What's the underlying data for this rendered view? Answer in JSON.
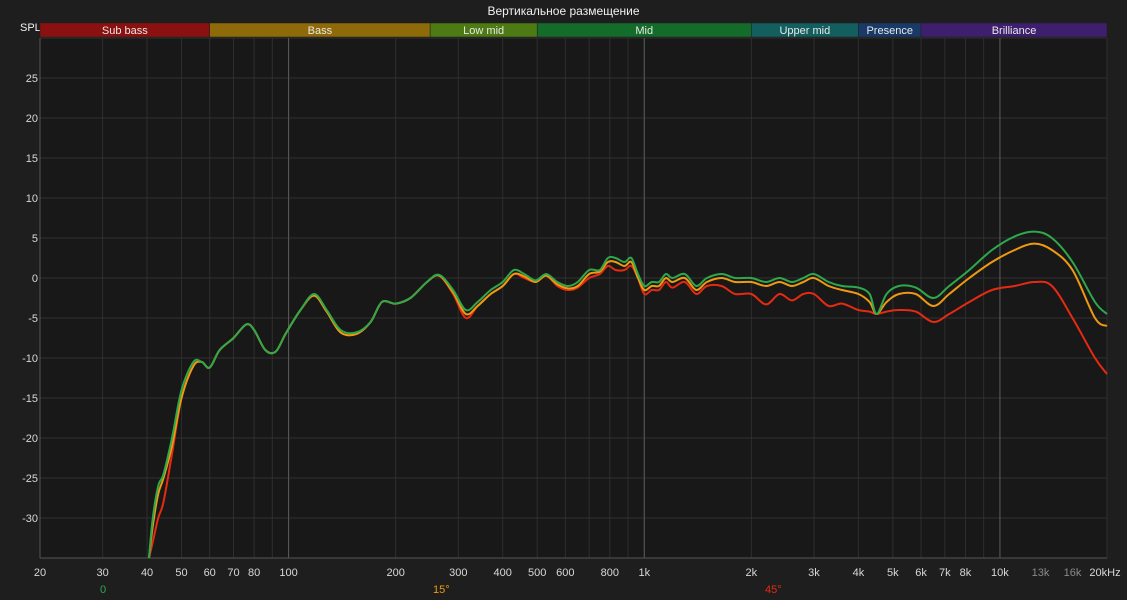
{
  "chart_data": {
    "type": "line",
    "title": "Вертикальное размещение",
    "ylabel": "SPL",
    "xscale": "log",
    "xlim": [
      20,
      20000
    ],
    "ylim": [
      -35,
      30
    ],
    "grid": true,
    "yticks": [
      25,
      20,
      15,
      10,
      5,
      0,
      -5,
      -10,
      -15,
      -20,
      -25,
      -30
    ],
    "xticks": [
      {
        "v": 20,
        "label": "20",
        "major": false
      },
      {
        "v": 30,
        "label": "30",
        "major": false
      },
      {
        "v": 40,
        "label": "40",
        "major": false
      },
      {
        "v": 50,
        "label": "50",
        "major": false
      },
      {
        "v": 60,
        "label": "60",
        "major": false
      },
      {
        "v": 70,
        "label": "70",
        "major": false
      },
      {
        "v": 80,
        "label": "80",
        "major": false
      },
      {
        "v": 100,
        "label": "100",
        "major": true
      },
      {
        "v": 200,
        "label": "200",
        "major": false
      },
      {
        "v": 300,
        "label": "300",
        "major": false
      },
      {
        "v": 400,
        "label": "400",
        "major": false
      },
      {
        "v": 500,
        "label": "500",
        "major": false
      },
      {
        "v": 600,
        "label": "600",
        "major": false
      },
      {
        "v": 800,
        "label": "800",
        "major": false
      },
      {
        "v": 1000,
        "label": "1k",
        "major": true
      },
      {
        "v": 2000,
        "label": "2k",
        "major": false
      },
      {
        "v": 3000,
        "label": "3k",
        "major": false
      },
      {
        "v": 4000,
        "label": "4k",
        "major": false
      },
      {
        "v": 5000,
        "label": "5k",
        "major": false
      },
      {
        "v": 6000,
        "label": "6k",
        "major": false
      },
      {
        "v": 7000,
        "label": "7k",
        "major": false
      },
      {
        "v": 8000,
        "label": "8k",
        "major": false
      },
      {
        "v": 10000,
        "label": "10k",
        "major": true
      },
      {
        "v": 13000,
        "label": "13k",
        "major": false,
        "dim": true
      },
      {
        "v": 16000,
        "label": "16k",
        "major": false,
        "dim": true
      },
      {
        "v": 20000,
        "label": "20kHz",
        "major": false
      }
    ],
    "bands": [
      {
        "label": "Sub bass",
        "from": 20,
        "to": 60,
        "color": "#8b1010"
      },
      {
        "label": "Bass",
        "from": 60,
        "to": 250,
        "color": "#8f6a08"
      },
      {
        "label": "Low mid",
        "from": 250,
        "to": 500,
        "color": "#4d7a12"
      },
      {
        "label": "Mid",
        "from": 500,
        "to": 2000,
        "color": "#136c2a"
      },
      {
        "label": "Upper mid",
        "from": 2000,
        "to": 4000,
        "color": "#135e5e"
      },
      {
        "label": "Presence",
        "from": 4000,
        "to": 6000,
        "color": "#193a66"
      },
      {
        "label": "Brilliance",
        "from": 6000,
        "to": 20000,
        "color": "#3e1f6e"
      }
    ],
    "series": [
      {
        "name": "0",
        "color": "#2ea84a",
        "points": [
          [
            40.5,
            -35
          ],
          [
            41.5,
            -30
          ],
          [
            43,
            -26
          ],
          [
            44.5,
            -24.5
          ],
          [
            47,
            -20
          ],
          [
            50,
            -14
          ],
          [
            54,
            -10.5
          ],
          [
            57,
            -10.5
          ],
          [
            60,
            -11.2
          ],
          [
            64,
            -9
          ],
          [
            70,
            -7.5
          ],
          [
            76,
            -5.8
          ],
          [
            80,
            -6.5
          ],
          [
            86,
            -9
          ],
          [
            92,
            -9.2
          ],
          [
            98,
            -7
          ],
          [
            108,
            -4
          ],
          [
            118,
            -2
          ],
          [
            128,
            -4
          ],
          [
            140,
            -6.5
          ],
          [
            155,
            -6.8
          ],
          [
            170,
            -5.5
          ],
          [
            183,
            -3
          ],
          [
            200,
            -3.2
          ],
          [
            220,
            -2.5
          ],
          [
            245,
            -0.5
          ],
          [
            265,
            0.4
          ],
          [
            290,
            -1.5
          ],
          [
            315,
            -4
          ],
          [
            340,
            -3
          ],
          [
            370,
            -1.5
          ],
          [
            400,
            -0.5
          ],
          [
            430,
            1
          ],
          [
            460,
            0.5
          ],
          [
            495,
            -0.3
          ],
          [
            530,
            0.5
          ],
          [
            570,
            -0.5
          ],
          [
            610,
            -1
          ],
          [
            650,
            -0.5
          ],
          [
            700,
            1
          ],
          [
            750,
            1
          ],
          [
            790,
            2.5
          ],
          [
            830,
            2.5
          ],
          [
            880,
            2
          ],
          [
            920,
            2.5
          ],
          [
            960,
            0.5
          ],
          [
            1000,
            -1
          ],
          [
            1050,
            -0.5
          ],
          [
            1100,
            -0.5
          ],
          [
            1150,
            0.5
          ],
          [
            1200,
            0
          ],
          [
            1300,
            0.5
          ],
          [
            1400,
            -1
          ],
          [
            1500,
            0
          ],
          [
            1650,
            0.5
          ],
          [
            1800,
            0
          ],
          [
            2000,
            0
          ],
          [
            2200,
            -0.5
          ],
          [
            2400,
            0
          ],
          [
            2600,
            -0.5
          ],
          [
            2800,
            0
          ],
          [
            3000,
            0.5
          ],
          [
            3300,
            -0.5
          ],
          [
            3600,
            -1
          ],
          [
            4000,
            -1.2
          ],
          [
            4300,
            -2
          ],
          [
            4500,
            -4.5
          ],
          [
            4800,
            -2
          ],
          [
            5200,
            -1
          ],
          [
            5800,
            -1.2
          ],
          [
            6500,
            -2.5
          ],
          [
            7200,
            -1
          ],
          [
            8200,
            1
          ],
          [
            9500,
            3.5
          ],
          [
            11000,
            5.2
          ],
          [
            12500,
            5.8
          ],
          [
            14000,
            5
          ],
          [
            16000,
            2
          ],
          [
            18500,
            -3
          ],
          [
            20000,
            -4.5
          ]
        ]
      },
      {
        "name": "15°",
        "color": "#ee9a10",
        "points": [
          [
            40.5,
            -35
          ],
          [
            41.5,
            -31
          ],
          [
            43,
            -27
          ],
          [
            44.5,
            -25
          ],
          [
            47,
            -21
          ],
          [
            50,
            -15
          ],
          [
            54,
            -11
          ],
          [
            57,
            -10.5
          ],
          [
            60,
            -11.2
          ],
          [
            64,
            -9
          ],
          [
            70,
            -7.5
          ],
          [
            76,
            -5.8
          ],
          [
            80,
            -6.5
          ],
          [
            86,
            -9
          ],
          [
            92,
            -9.2
          ],
          [
            98,
            -7
          ],
          [
            108,
            -4
          ],
          [
            118,
            -2.2
          ],
          [
            128,
            -4.2
          ],
          [
            140,
            -6.8
          ],
          [
            155,
            -7
          ],
          [
            170,
            -5.5
          ],
          [
            183,
            -3
          ],
          [
            200,
            -3.2
          ],
          [
            220,
            -2.5
          ],
          [
            245,
            -0.5
          ],
          [
            265,
            0.3
          ],
          [
            290,
            -1.8
          ],
          [
            315,
            -4.5
          ],
          [
            340,
            -3.5
          ],
          [
            370,
            -2
          ],
          [
            400,
            -1
          ],
          [
            430,
            0.5
          ],
          [
            460,
            0.2
          ],
          [
            495,
            -0.5
          ],
          [
            530,
            0.3
          ],
          [
            570,
            -0.8
          ],
          [
            610,
            -1.3
          ],
          [
            650,
            -1
          ],
          [
            700,
            0.5
          ],
          [
            750,
            0.8
          ],
          [
            790,
            2
          ],
          [
            830,
            2
          ],
          [
            880,
            1.5
          ],
          [
            920,
            2
          ],
          [
            960,
            0
          ],
          [
            1000,
            -1.5
          ],
          [
            1050,
            -1
          ],
          [
            1100,
            -1
          ],
          [
            1150,
            0
          ],
          [
            1200,
            -0.5
          ],
          [
            1300,
            0
          ],
          [
            1400,
            -1.5
          ],
          [
            1500,
            -0.5
          ],
          [
            1650,
            0
          ],
          [
            1800,
            -0.5
          ],
          [
            2000,
            -0.5
          ],
          [
            2200,
            -1
          ],
          [
            2400,
            -0.5
          ],
          [
            2600,
            -1
          ],
          [
            2800,
            -0.5
          ],
          [
            3000,
            0
          ],
          [
            3300,
            -1
          ],
          [
            3600,
            -1.5
          ],
          [
            4000,
            -2
          ],
          [
            4300,
            -3
          ],
          [
            4500,
            -4.5
          ],
          [
            4800,
            -3
          ],
          [
            5200,
            -2
          ],
          [
            5800,
            -2
          ],
          [
            6500,
            -3.5
          ],
          [
            7200,
            -2
          ],
          [
            8200,
            0
          ],
          [
            9500,
            2
          ],
          [
            11000,
            3.5
          ],
          [
            12500,
            4.3
          ],
          [
            14000,
            3.5
          ],
          [
            16000,
            1
          ],
          [
            18500,
            -5
          ],
          [
            20000,
            -6
          ]
        ]
      },
      {
        "name": "45°",
        "color": "#e62a12",
        "points": [
          [
            40.5,
            -35
          ],
          [
            41.5,
            -33
          ],
          [
            43,
            -30
          ],
          [
            44.5,
            -28
          ],
          [
            47,
            -22
          ],
          [
            50,
            -15
          ],
          [
            54,
            -11
          ],
          [
            57,
            -10.5
          ],
          [
            60,
            -11.2
          ],
          [
            64,
            -9
          ],
          [
            70,
            -7.5
          ],
          [
            76,
            -5.8
          ],
          [
            80,
            -6.5
          ],
          [
            86,
            -9
          ],
          [
            92,
            -9.2
          ],
          [
            98,
            -7
          ],
          [
            108,
            -4
          ],
          [
            118,
            -2.2
          ],
          [
            128,
            -4.2
          ],
          [
            140,
            -6.8
          ],
          [
            155,
            -7
          ],
          [
            170,
            -5.5
          ],
          [
            183,
            -3
          ],
          [
            200,
            -3.2
          ],
          [
            220,
            -2.5
          ],
          [
            245,
            -0.5
          ],
          [
            265,
            0.3
          ],
          [
            290,
            -2
          ],
          [
            315,
            -5
          ],
          [
            340,
            -3.5
          ],
          [
            370,
            -2
          ],
          [
            400,
            -1
          ],
          [
            430,
            0.5
          ],
          [
            460,
            0
          ],
          [
            495,
            -0.5
          ],
          [
            530,
            0.3
          ],
          [
            570,
            -1
          ],
          [
            610,
            -1.5
          ],
          [
            650,
            -1.2
          ],
          [
            700,
            0
          ],
          [
            750,
            0.5
          ],
          [
            790,
            1.5
          ],
          [
            830,
            1
          ],
          [
            880,
            1
          ],
          [
            920,
            1.5
          ],
          [
            960,
            0
          ],
          [
            1000,
            -2
          ],
          [
            1050,
            -1.5
          ],
          [
            1100,
            -1.5
          ],
          [
            1150,
            -0.5
          ],
          [
            1200,
            -1.2
          ],
          [
            1300,
            -0.5
          ],
          [
            1400,
            -2
          ],
          [
            1500,
            -1
          ],
          [
            1650,
            -1
          ],
          [
            1800,
            -2
          ],
          [
            2000,
            -2
          ],
          [
            2200,
            -3.3
          ],
          [
            2400,
            -2
          ],
          [
            2600,
            -2.8
          ],
          [
            2800,
            -2
          ],
          [
            3000,
            -2
          ],
          [
            3300,
            -3.5
          ],
          [
            3600,
            -3.2
          ],
          [
            4000,
            -4
          ],
          [
            4300,
            -4.2
          ],
          [
            4500,
            -4.5
          ],
          [
            4800,
            -4.2
          ],
          [
            5200,
            -4
          ],
          [
            5800,
            -4.2
          ],
          [
            6500,
            -5.5
          ],
          [
            7200,
            -4.5
          ],
          [
            8200,
            -3
          ],
          [
            9500,
            -1.5
          ],
          [
            11000,
            -1
          ],
          [
            12500,
            -0.5
          ],
          [
            14000,
            -1
          ],
          [
            16000,
            -5
          ],
          [
            18500,
            -10
          ],
          [
            20000,
            -12
          ]
        ]
      }
    ]
  },
  "legend": [
    {
      "label": "0",
      "color": "#2ea84a"
    },
    {
      "label": "15°",
      "color": "#ee9a10"
    },
    {
      "label": "45°",
      "color": "#e62a12"
    }
  ]
}
